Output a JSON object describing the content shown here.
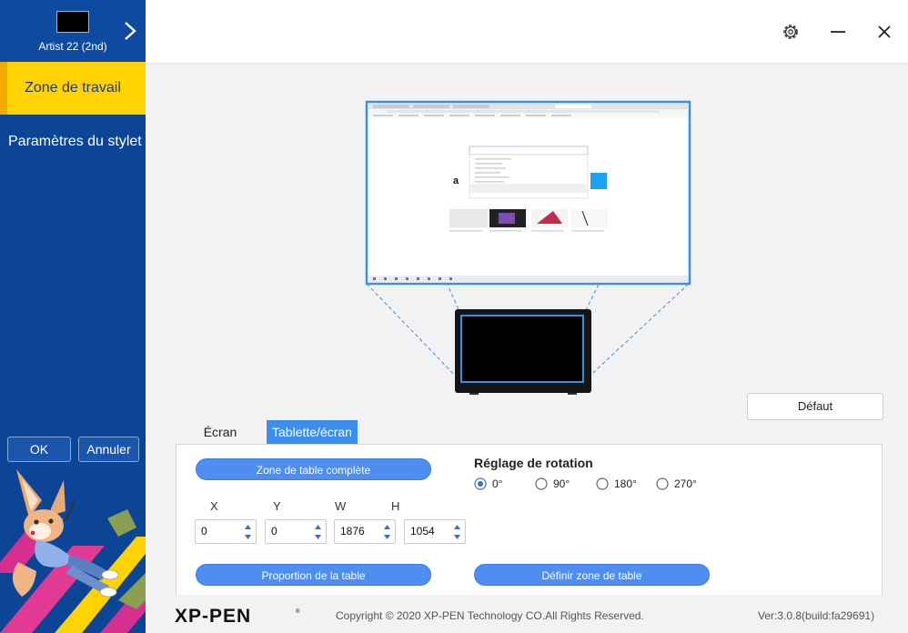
{
  "device": {
    "name": "Artist 22 (2nd)"
  },
  "sidebar": {
    "items": [
      {
        "label": "Zone de travail",
        "active": true
      },
      {
        "label": "Paramètres du stylet",
        "active": false
      }
    ],
    "ok_label": "OK",
    "cancel_label": "Annuler"
  },
  "topbar": {
    "icons": [
      "gear-icon",
      "minimize-icon",
      "close-icon"
    ]
  },
  "actions": {
    "default_label": "Défaut"
  },
  "tabs": [
    {
      "label": "Écran",
      "active": false
    },
    {
      "label": "Tablette/écran",
      "active": true
    }
  ],
  "panel": {
    "full_area_label": "Zone de table complète",
    "proportion_label": "Proportion de la table",
    "define_area_label": "Définir zone de table",
    "coords": [
      {
        "label": "X",
        "value": "0"
      },
      {
        "label": "Y",
        "value": "0"
      },
      {
        "label": "W",
        "value": "1876"
      },
      {
        "label": "H",
        "value": "1054"
      }
    ],
    "rotation": {
      "title": "Réglage de rotation",
      "options": [
        {
          "label": "0°",
          "selected": true
        },
        {
          "label": "90°",
          "selected": false
        },
        {
          "label": "180°",
          "selected": false
        },
        {
          "label": "270°",
          "selected": false
        }
      ]
    }
  },
  "footer": {
    "brand": "XP-PEN",
    "copyright": "Copyright © 2020 XP-PEN Technology CO.All Rights Reserved.",
    "version": "Ver:3.0.8(build:fa29691)"
  },
  "colors": {
    "sidebar": "#0c4596",
    "active_nav": "#ffd200",
    "accent": "#3b8ef0",
    "area_outline": "#3a8fe0"
  }
}
